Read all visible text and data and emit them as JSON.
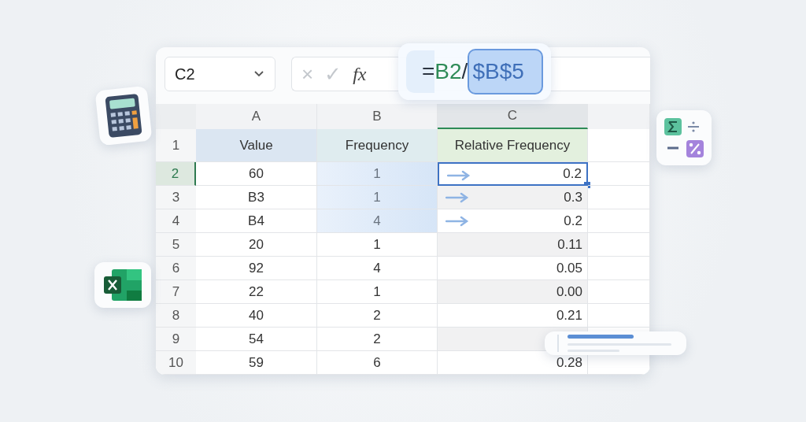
{
  "name_box": {
    "value": "C2"
  },
  "formula_bar": {
    "cancel": "×",
    "confirm": "✓",
    "function": "fx"
  },
  "formula": [
    {
      "text": "=",
      "color": "#2b3440",
      "selected": false
    },
    {
      "text": "B2",
      "color": "#2e8b57",
      "selected": false
    },
    {
      "text": "/",
      "color": "#2b3440",
      "selected": false
    },
    {
      "text": "$B$5",
      "color": "#3f6fb8",
      "selected": true
    }
  ],
  "columns": [
    {
      "label": "A",
      "selected": false
    },
    {
      "label": "B",
      "selected": false
    },
    {
      "label": "C",
      "selected": true
    }
  ],
  "rows": [
    {
      "number": "1",
      "selected": false,
      "kind": "header",
      "cells": [
        {
          "text": "Value",
          "selected": false
        },
        {
          "text": "Frequency",
          "selected": false
        },
        {
          "text": "Relative Frequency",
          "selected": false
        }
      ]
    },
    {
      "number": "2",
      "selected": true,
      "highlighted": true,
      "cells": [
        {
          "text": "60",
          "selected": false
        },
        {
          "text": "1",
          "selected": false
        },
        {
          "text": "0.2",
          "selected": true
        }
      ]
    },
    {
      "number": "3",
      "selected": false,
      "highlighted": true,
      "cells": [
        {
          "text": "B3",
          "selected": false
        },
        {
          "text": "1",
          "selected": false
        },
        {
          "text": "0.3",
          "selected": false
        }
      ]
    },
    {
      "number": "4",
      "selected": false,
      "highlighted": true,
      "cells": [
        {
          "text": "B4",
          "selected": false
        },
        {
          "text": "4",
          "selected": false
        },
        {
          "text": "0.2",
          "selected": false
        }
      ]
    },
    {
      "number": "5",
      "selected": false,
      "highlighted": false,
      "cells": [
        {
          "text": "20",
          "selected": false
        },
        {
          "text": "1",
          "selected": false
        },
        {
          "text": "0.11",
          "selected": false
        }
      ]
    },
    {
      "number": "6",
      "selected": false,
      "highlighted": false,
      "cells": [
        {
          "text": "92",
          "selected": false
        },
        {
          "text": "4",
          "selected": false
        },
        {
          "text": "0.05",
          "selected": false
        }
      ]
    },
    {
      "number": "7",
      "selected": false,
      "highlighted": false,
      "cells": [
        {
          "text": "22",
          "selected": false
        },
        {
          "text": "1",
          "selected": false
        },
        {
          "text": "0.00",
          "selected": false
        }
      ]
    },
    {
      "number": "8",
      "selected": false,
      "highlighted": false,
      "cells": [
        {
          "text": "40",
          "selected": false
        },
        {
          "text": "2",
          "selected": false
        },
        {
          "text": "0.21",
          "selected": false
        }
      ]
    },
    {
      "number": "9",
      "selected": false,
      "highlighted": false,
      "cells": [
        {
          "text": "54",
          "selected": false
        },
        {
          "text": "2",
          "selected": false
        },
        {
          "selected": false
        }
      ]
    },
    {
      "number": "10",
      "selected": false,
      "highlighted": false,
      "cells": [
        {
          "text": "59",
          "selected": false
        },
        {
          "text": "6",
          "selected": false
        },
        {
          "text": "0.28",
          "selected": false
        }
      ]
    }
  ]
}
